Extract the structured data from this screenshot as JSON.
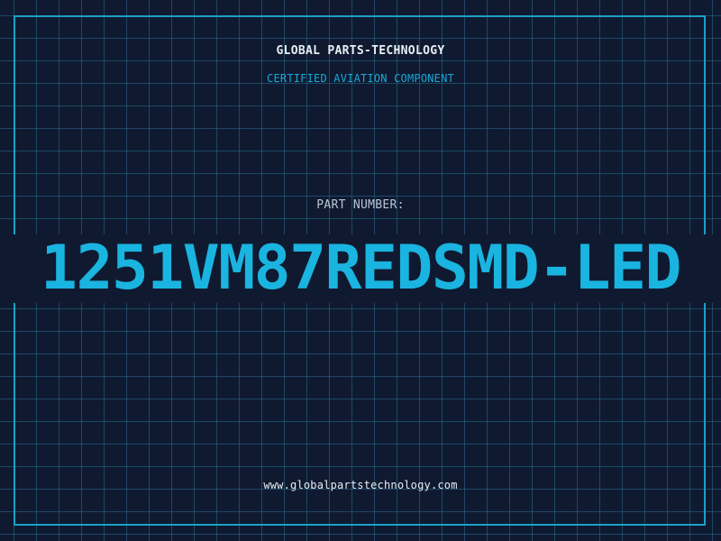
{
  "header": {
    "company_name": "GLOBAL PARTS-TECHNOLOGY",
    "tagline": "CERTIFIED AVIATION COMPONENT"
  },
  "part": {
    "label": "PART NUMBER:",
    "number": "1251VM87REDSMD-LED"
  },
  "footer": {
    "website": "www.globalpartstechnology.com"
  },
  "colors": {
    "background": "#0f1a30",
    "grid": "#286e8c",
    "accent": "#1ab4e0",
    "text": "#e8eef5"
  }
}
